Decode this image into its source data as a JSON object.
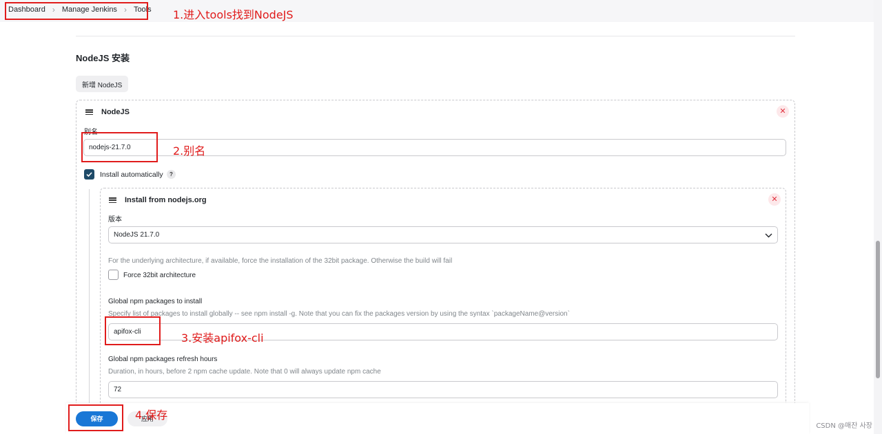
{
  "breadcrumb": [
    "Dashboard",
    "Manage Jenkins",
    "Tools"
  ],
  "annotations": {
    "step1": "1.进入tools找到NodeJS",
    "step2": "2.别名",
    "step3": "3.安装apifox-cli",
    "step4": "4.保存"
  },
  "section": {
    "title": "NodeJS 安装",
    "add_button": "新增 NodeJS"
  },
  "nodejs_card": {
    "title": "NodeJS",
    "alias_label": "别名",
    "alias_value": "nodejs-21.7.0",
    "install_auto_label": "Install automatically",
    "install_auto_checked": true,
    "help_icon": "?"
  },
  "installer_card": {
    "title": "Install from nodejs.org",
    "version_label": "版本",
    "version_value": "NodeJS 21.7.0",
    "arch_help": "For the underlying architecture, if available, force the installation of the 32bit package. Otherwise the build will fail",
    "force32_label": "Force 32bit architecture",
    "force32_checked": false,
    "npm_packages_label": "Global npm packages to install",
    "npm_packages_help": "Specify list of packages to install globally -- see npm install -g. Note that you can fix the packages version by using the syntax `packageName@version`",
    "npm_packages_value": "apifox-cli",
    "refresh_label": "Global npm packages refresh hours",
    "refresh_help": "Duration, in hours, before 2 npm cache update. Note that 0 will always update npm cache",
    "refresh_value": "72"
  },
  "footer": {
    "save": "保存",
    "apply": "应用"
  },
  "watermark": "CSDN @매잔 사장",
  "colors": {
    "annotation": "#e01b1b",
    "primary": "#1977d6",
    "checkbox": "#1e4a68"
  }
}
